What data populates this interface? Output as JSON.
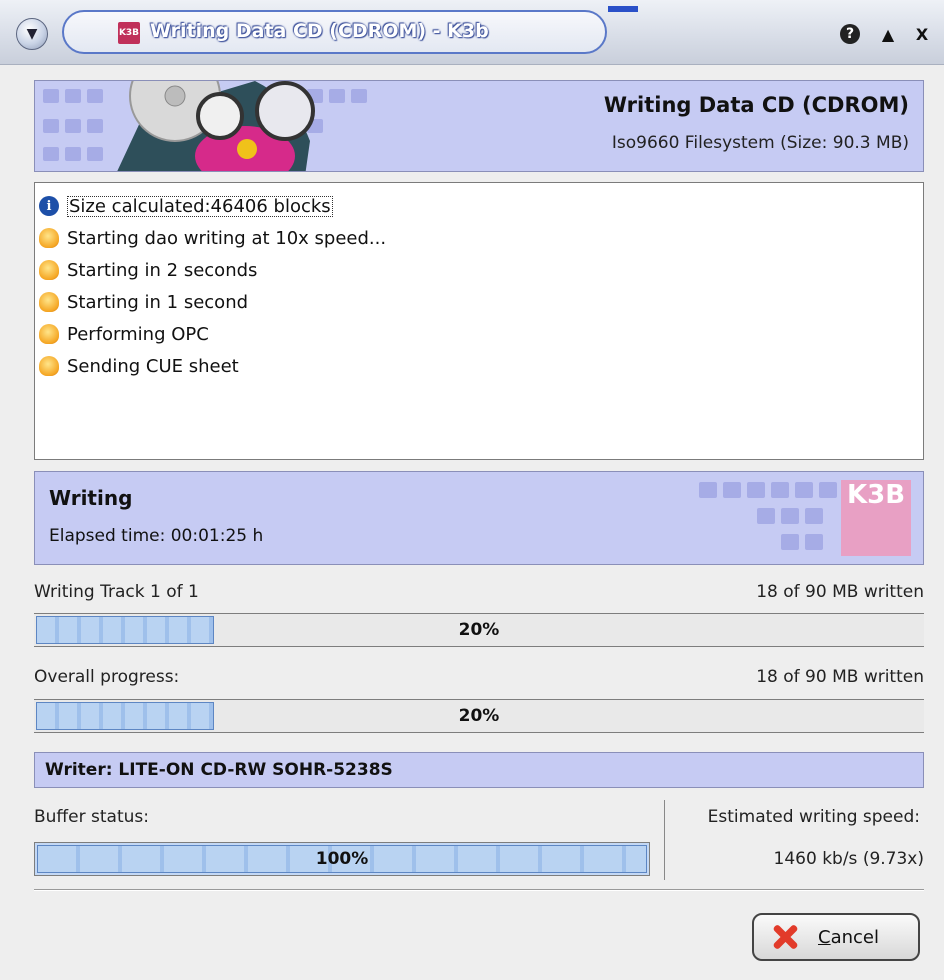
{
  "window": {
    "title": "Writing Data CD (CDROM) - K3b",
    "app_icon": "k3b-icon",
    "buttons": {
      "help": "?",
      "shade": "▲",
      "close": "X"
    }
  },
  "header": {
    "title": "Writing Data CD (CDROM)",
    "subtitle": "Iso9660 Filesystem (Size: 90.3 MB)"
  },
  "log": [
    {
      "icon": "info-icon",
      "text": "Size calculated:46406 blocks"
    },
    {
      "icon": "working-icon",
      "text": "Starting dao writing at 10x speed..."
    },
    {
      "icon": "working-icon",
      "text": "Starting in 2 seconds"
    },
    {
      "icon": "working-icon",
      "text": "Starting in 1 second"
    },
    {
      "icon": "working-icon",
      "text": "Performing OPC"
    },
    {
      "icon": "working-icon",
      "text": "Sending CUE sheet"
    }
  ],
  "status": {
    "title": "Writing",
    "elapsed": "Elapsed time: 00:01:25 h",
    "logo_text": "K3B"
  },
  "track": {
    "label": "Writing Track 1 of 1",
    "written": "18 of 90 MB written",
    "percent_text": "20%",
    "fraction": 0.2
  },
  "overall": {
    "label": "Overall progress:",
    "written": "18 of 90 MB written",
    "percent_text": "20%",
    "fraction": 0.2
  },
  "writer": {
    "label": "Writer: LITE-ON CD-RW SOHR-5238S"
  },
  "buffer": {
    "label": "Buffer status:",
    "percent_text": "100%",
    "fraction": 1.0
  },
  "speed": {
    "label": "Estimated writing speed:",
    "value": "1460 kb/s (9.73x)"
  },
  "cancel": {
    "mnemonic": "C",
    "rest": "ancel"
  },
  "colors": {
    "accent": "#c6cbf3",
    "progress": "#b9d3f2",
    "title_border": "#5a78c8"
  }
}
